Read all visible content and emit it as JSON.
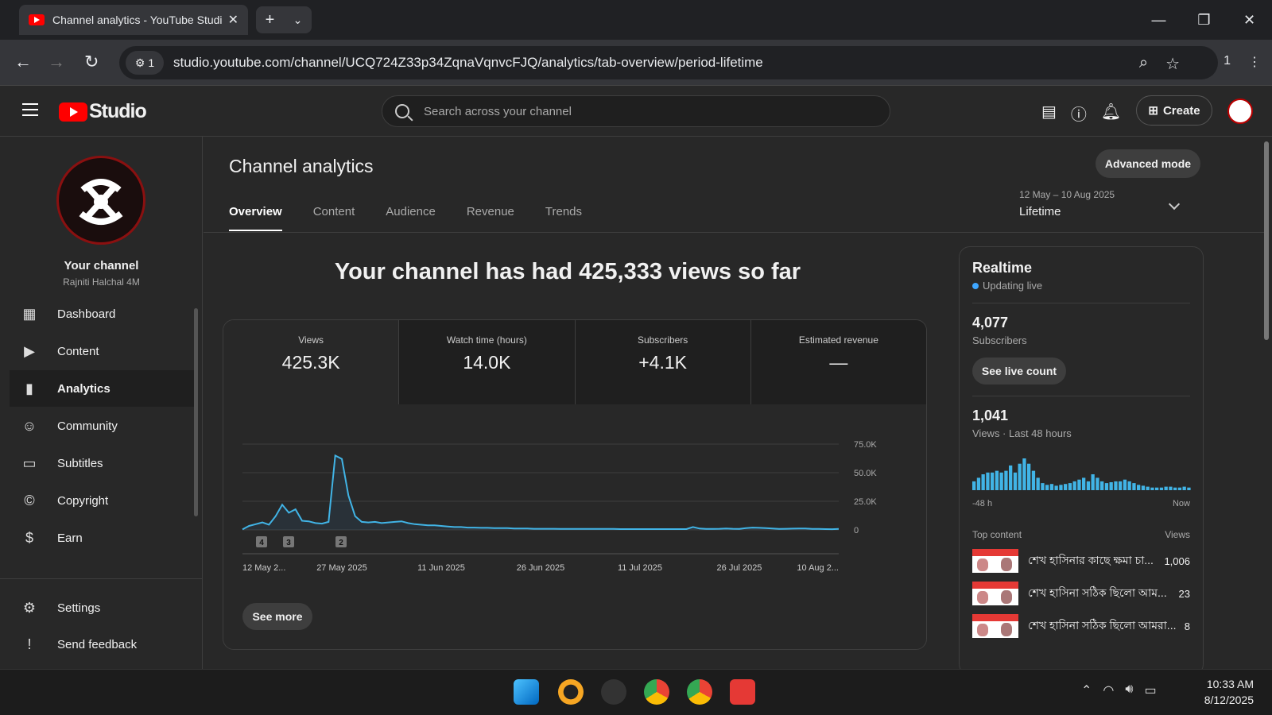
{
  "browser": {
    "tab_title": "Channel analytics - YouTube Studio",
    "url": "studio.youtube.com/channel/UCQ724Z33p34ZqnaVqnvcFJQ/analytics/tab-overview/period-lifetime",
    "site_info_badge": "1",
    "extensions_count": "1"
  },
  "studio": {
    "logo_text": "Studio",
    "search_placeholder": "Search across your channel",
    "create_label": "Create"
  },
  "sidebar": {
    "channel_label": "Your channel",
    "channel_name": "Rajniti Halchal 4M",
    "items": [
      {
        "label": "Dashboard",
        "icon": "dashboard-icon"
      },
      {
        "label": "Content",
        "icon": "content-icon"
      },
      {
        "label": "Analytics",
        "icon": "analytics-icon",
        "active": true
      },
      {
        "label": "Community",
        "icon": "community-icon"
      },
      {
        "label": "Subtitles",
        "icon": "subtitles-icon"
      },
      {
        "label": "Copyright",
        "icon": "copyright-icon"
      },
      {
        "label": "Earn",
        "icon": "earn-icon"
      }
    ],
    "settings_label": "Settings",
    "feedback_label": "Send feedback"
  },
  "main": {
    "title": "Channel analytics",
    "advanced_label": "Advanced mode",
    "tabs": [
      "Overview",
      "Content",
      "Audience",
      "Revenue",
      "Trends"
    ],
    "period_range": "12 May – 10 Aug 2025",
    "period_label": "Lifetime",
    "headline": "Your channel has had 425,333 views so far",
    "metrics": [
      {
        "label": "Views",
        "value": "425.3K"
      },
      {
        "label": "Watch time (hours)",
        "value": "14.0K"
      },
      {
        "label": "Subscribers",
        "value": "+4.1K"
      },
      {
        "label": "Estimated revenue",
        "value": "—"
      }
    ],
    "see_more_label": "See more"
  },
  "chart_data": {
    "type": "line",
    "series": [
      {
        "name": "Views",
        "values": [
          400,
          3500,
          5000,
          6500,
          4500,
          12000,
          22000,
          15000,
          18000,
          8000,
          7500,
          6000,
          5500,
          7000,
          65000,
          62000,
          30000,
          12000,
          7000,
          6500,
          7000,
          6000,
          6500,
          7000,
          7500,
          6000,
          5000,
          4500,
          4000,
          4000,
          3500,
          3000,
          2500,
          2500,
          2000,
          2000,
          1800,
          1800,
          1500,
          1500,
          1500,
          1200,
          1200,
          1200,
          1000,
          1000,
          1000,
          1000,
          900,
          900,
          900,
          900,
          800,
          800,
          800,
          800,
          800,
          700,
          700,
          700,
          700,
          700,
          700,
          700,
          700,
          700,
          700,
          700,
          2500,
          1200,
          900,
          900,
          1000,
          1200,
          1000,
          900,
          1500,
          2000,
          1800,
          1500,
          1200,
          900,
          1000,
          1100,
          1200,
          1200,
          900,
          800,
          700,
          600,
          800
        ]
      }
    ],
    "x_tick_labels": [
      "12 May 2...",
      "27 May 2025",
      "11 Jun 2025",
      "26 Jun 2025",
      "11 Jul 2025",
      "26 Jul 2025",
      "10 Aug 2..."
    ],
    "y_tick_labels": [
      "75.0K",
      "50.0K",
      "25.0K",
      "0"
    ],
    "ylim": [
      0,
      75000
    ],
    "annotation_markers": [
      "4",
      "3",
      "2"
    ]
  },
  "realtime": {
    "title": "Realtime",
    "status": "Updating live",
    "subscribers_value": "4,077",
    "subscribers_label": "Subscribers",
    "live_count_label": "See live count",
    "views_value": "1,041",
    "views_label": "Views · Last 48 hours",
    "bars": [
      10,
      14,
      18,
      20,
      20,
      22,
      20,
      22,
      28,
      20,
      30,
      36,
      30,
      22,
      14,
      8,
      6,
      7,
      5,
      6,
      7,
      8,
      10,
      12,
      14,
      10,
      18,
      14,
      10,
      8,
      9,
      10,
      10,
      12,
      10,
      8,
      6,
      5,
      4,
      3,
      3,
      3,
      4,
      4,
      3,
      3,
      4,
      3
    ],
    "axis_start": "-48 h",
    "axis_end": "Now",
    "top_content_label": "Top content",
    "top_content_views_label": "Views",
    "top_content": [
      {
        "title": "শেখ হাসিনার কাছে ক্ষমা চা...",
        "views": "1,006"
      },
      {
        "title": "শেখ হাসিনা সঠিক ছিলো আম...",
        "views": "23"
      },
      {
        "title": "শেখ হাসিনা সঠিক ছিলো আমরা...",
        "views": "8"
      }
    ]
  },
  "taskbar": {
    "time": "10:33 AM",
    "date": "8/12/2025"
  }
}
